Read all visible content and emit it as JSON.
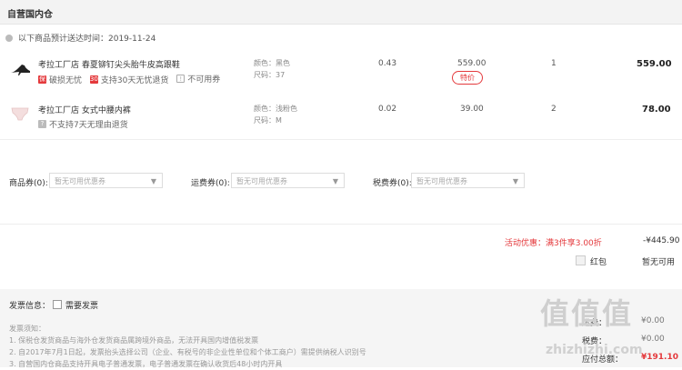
{
  "header": {
    "title": "自营国内仓"
  },
  "delivery": {
    "text": "以下商品预计送达时间：2019-11-24"
  },
  "items": [
    {
      "name": "考拉工厂店 春夏铆钉尖头胎牛皮高跟鞋",
      "tags": [
        {
          "icon": "保",
          "text": "破损无忧"
        },
        {
          "icon": "30",
          "text": "支持30天无忧退货"
        },
        {
          "icon": "!",
          "text": "不可用券"
        }
      ],
      "color": "颜色：黑色",
      "size": "尺码：37",
      "weight": "0.43",
      "price": "559.00",
      "badge": "特价",
      "qty": "1",
      "subtotal": "559.00"
    },
    {
      "name": "考拉工厂店 女式中腰内裤",
      "tags": [
        {
          "icon": "?",
          "text": "不支持7天无理由退货"
        }
      ],
      "color": "颜色：浅粉色",
      "size": "尺码：M",
      "weight": "0.02",
      "price": "39.00",
      "qty": "2",
      "subtotal": "78.00"
    }
  ],
  "coupons": [
    {
      "label": "商品券(0):",
      "placeholder": "暂无可用优惠券"
    },
    {
      "label": "运费券(0):",
      "placeholder": "暂无可用优惠券"
    },
    {
      "label": "税费券(0):",
      "placeholder": "暂无可用优惠券"
    }
  ],
  "promo": {
    "label": "活动优惠：满3件享3.00折",
    "value": "-¥445.90"
  },
  "redpacket": {
    "label": "红包",
    "value": "暂无可用"
  },
  "invoice": {
    "label": "发票信息：",
    "check_label": "需要发票",
    "notes_title": "发票须知：",
    "notes": [
      "1. 保税仓发货商品与海外仓发货商品属跨境外商品，无法开具国内增值税发票",
      "2. 自2017年7月1日起，发票抬头选择公司（企业、有税号的非企业性单位和个体工商户）需提供纳税人识别号",
      "3. 自营国内仓商品支持开具电子普通发票，电子普通发票在确认收货后48小时内开具"
    ]
  },
  "summary": [
    {
      "label": "运费：",
      "value": "¥0.00"
    },
    {
      "label": "税费：",
      "value": "¥0.00"
    },
    {
      "label": "应付总额：",
      "value": "¥191.10"
    }
  ],
  "watermark": {
    "text": "值值值",
    "url": "zhizhizhi.com"
  },
  "colors": {
    "accent": "#e4393c"
  }
}
